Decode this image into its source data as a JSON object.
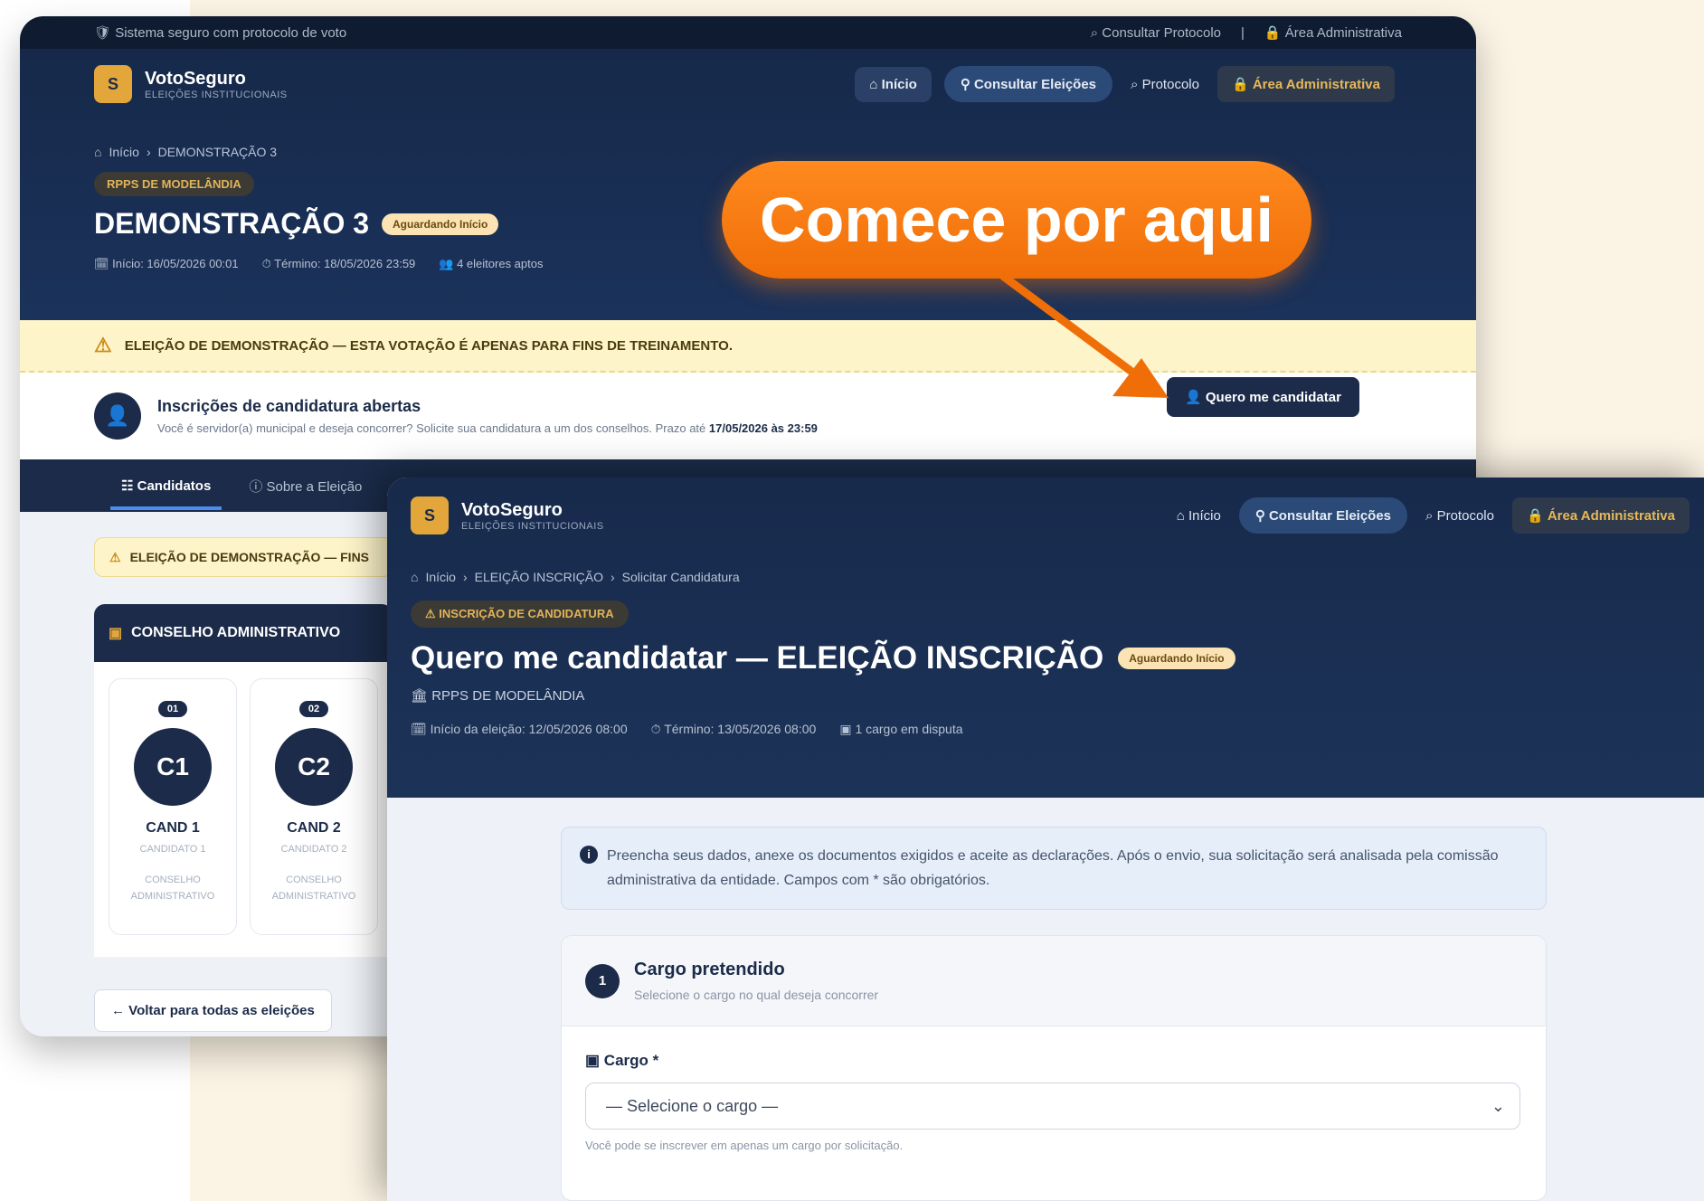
{
  "back": {
    "topbar": {
      "left": "Sistema seguro com protocolo de voto",
      "consult": "Consultar Protocolo",
      "admin": "Área Administrativa"
    },
    "brand": {
      "name": "VotoSeguro",
      "sub": "ELEIÇÕES INSTITUCIONAIS"
    },
    "nav": {
      "inicio": "Início",
      "consultar": "Consultar Eleições",
      "protocolo": "Protocolo",
      "admin": "Área Administrativa"
    },
    "breadcrumb": {
      "home": "Início",
      "sep": "›",
      "current": "DEMONSTRAÇÃO 3"
    },
    "tag": "RPPS DE MODELÂNDIA",
    "title": "DEMONSTRAÇÃO 3",
    "badge": "Aguardando Início",
    "meta": {
      "inicio": "Início: 16/05/2026 00:01",
      "termino": "Término: 18/05/2026 23:59",
      "eleitores": "4 eleitores aptos"
    },
    "warning": "ELEIÇÃO DE DEMONSTRAÇÃO — ESTA VOTAÇÃO É APENAS PARA FINS DE TREINAMENTO.",
    "inscricoes": {
      "title": "Inscrições de candidatura abertas",
      "desc": "Você é servidor(a) municipal e deseja concorrer? Solicite sua candidatura a um dos conselhos. Prazo até",
      "deadline": "17/05/2026 às 23:59"
    },
    "cand_button": "Quero me candidatar",
    "tabs": [
      "Candidatos",
      "Sobre a Eleição"
    ],
    "warn2": "ELEIÇÃO DE DEMONSTRAÇÃO — FINS",
    "conselho": "CONSELHO ADMINISTRATIVO",
    "cards": [
      {
        "num": "01",
        "initials": "C1",
        "name": "CAND 1",
        "sub": "CANDIDATO 1",
        "desc": "CONSELHO ADMINISTRATIVO"
      },
      {
        "num": "02",
        "initials": "C2",
        "name": "CAND 2",
        "sub": "CANDIDATO 2",
        "desc": "CONSELHO ADMINISTRATIVO"
      }
    ],
    "voltar": "Voltar para todas as eleições"
  },
  "callout": "Comece por aqui",
  "front": {
    "brand": {
      "name": "VotoSeguro",
      "sub": "ELEIÇÕES INSTITUCIONAIS"
    },
    "nav": {
      "inicio": "Início",
      "consultar": "Consultar Eleições",
      "protocolo": "Protocolo",
      "admin": "Área Administrativa"
    },
    "breadcrumb": {
      "home": "Início",
      "sep": "›",
      "election": "ELEIÇÃO INSCRIÇÃO",
      "current": "Solicitar Candidatura"
    },
    "tag": "INSCRIÇÃO DE CANDIDATURA",
    "title": "Quero me candidatar — ELEIÇÃO INSCRIÇÃO",
    "badge": "Aguardando Início",
    "org": "RPPS DE MODELÂNDIA",
    "meta": {
      "inicio": "Início da eleição: 12/05/2026 08:00",
      "termino": "Término: 13/05/2026 08:00",
      "cargos": "1 cargo em disputa"
    },
    "info": "Preencha seus dados, anexe os documentos exigidos e aceite as declarações. Após o envio, sua solicitação será analisada pela comissão administrativa da entidade. Campos com * são obrigatórios.",
    "section": {
      "number": "1",
      "title": "Cargo pretendido",
      "subtitle": "Selecione o cargo no qual deseja concorrer",
      "label": "Cargo *",
      "select_value": "— Selecione o cargo —",
      "hint": "Você pode se inscrever em apenas um cargo por solicitação."
    }
  },
  "colors": {
    "navy": "#1b2b49",
    "accent": "#f06e08",
    "gold": "#e2a63b"
  }
}
